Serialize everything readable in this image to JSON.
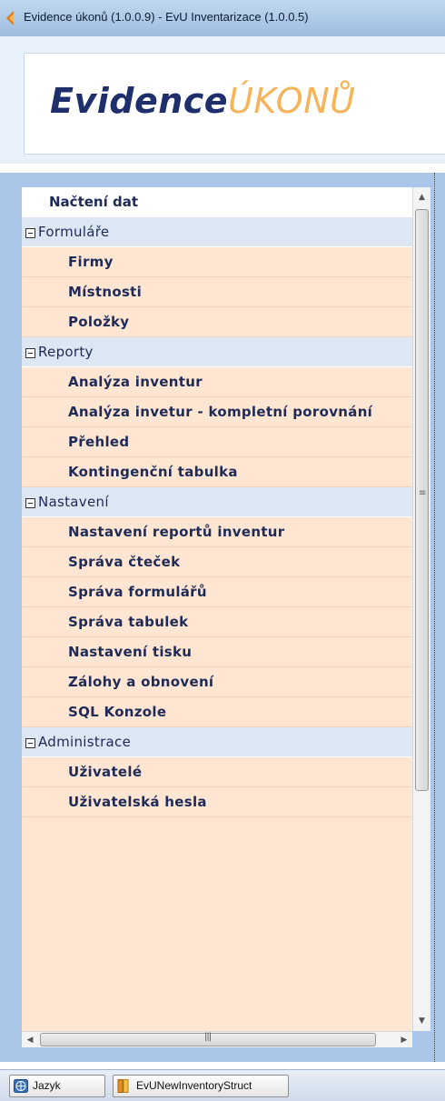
{
  "window": {
    "title": "Evidence úkonů (1.0.0.9) - EvU Inventarizace (1.0.0.5)"
  },
  "logo": {
    "part1": "Evidence",
    "part2": "ÚKONŮ"
  },
  "nav": {
    "top_item": "Načtení dat",
    "groups": [
      {
        "label": "Formuláře",
        "items": [
          "Firmy",
          "Místnosti",
          "Položky"
        ]
      },
      {
        "label": "Reporty",
        "items": [
          "Analýza inventur",
          "Analýza invetur - kompletní porovnání",
          "Přehled",
          "Kontingenční tabulka"
        ]
      },
      {
        "label": "Nastavení",
        "items": [
          "Nastavení reportů inventur",
          "Správa čteček",
          "Správa formulářů",
          "Správa tabulek",
          "Nastavení tisku",
          "Zálohy a obnovení",
          "SQL Konzole"
        ]
      },
      {
        "label": "Administrace",
        "items": [
          "Uživatelé",
          "Uživatelská hesla"
        ]
      }
    ]
  },
  "taskbar": {
    "buttons": [
      "Jazyk",
      "EvUNewInventoryStruct"
    ]
  },
  "colors": {
    "nav_background": "#aac7ea",
    "item_background": "#ffe6d3",
    "group_background": "#dde7f4",
    "item_text": "#1f2b57",
    "logo_dark": "#1e2f6b",
    "logo_accent": "#f5b45a"
  }
}
